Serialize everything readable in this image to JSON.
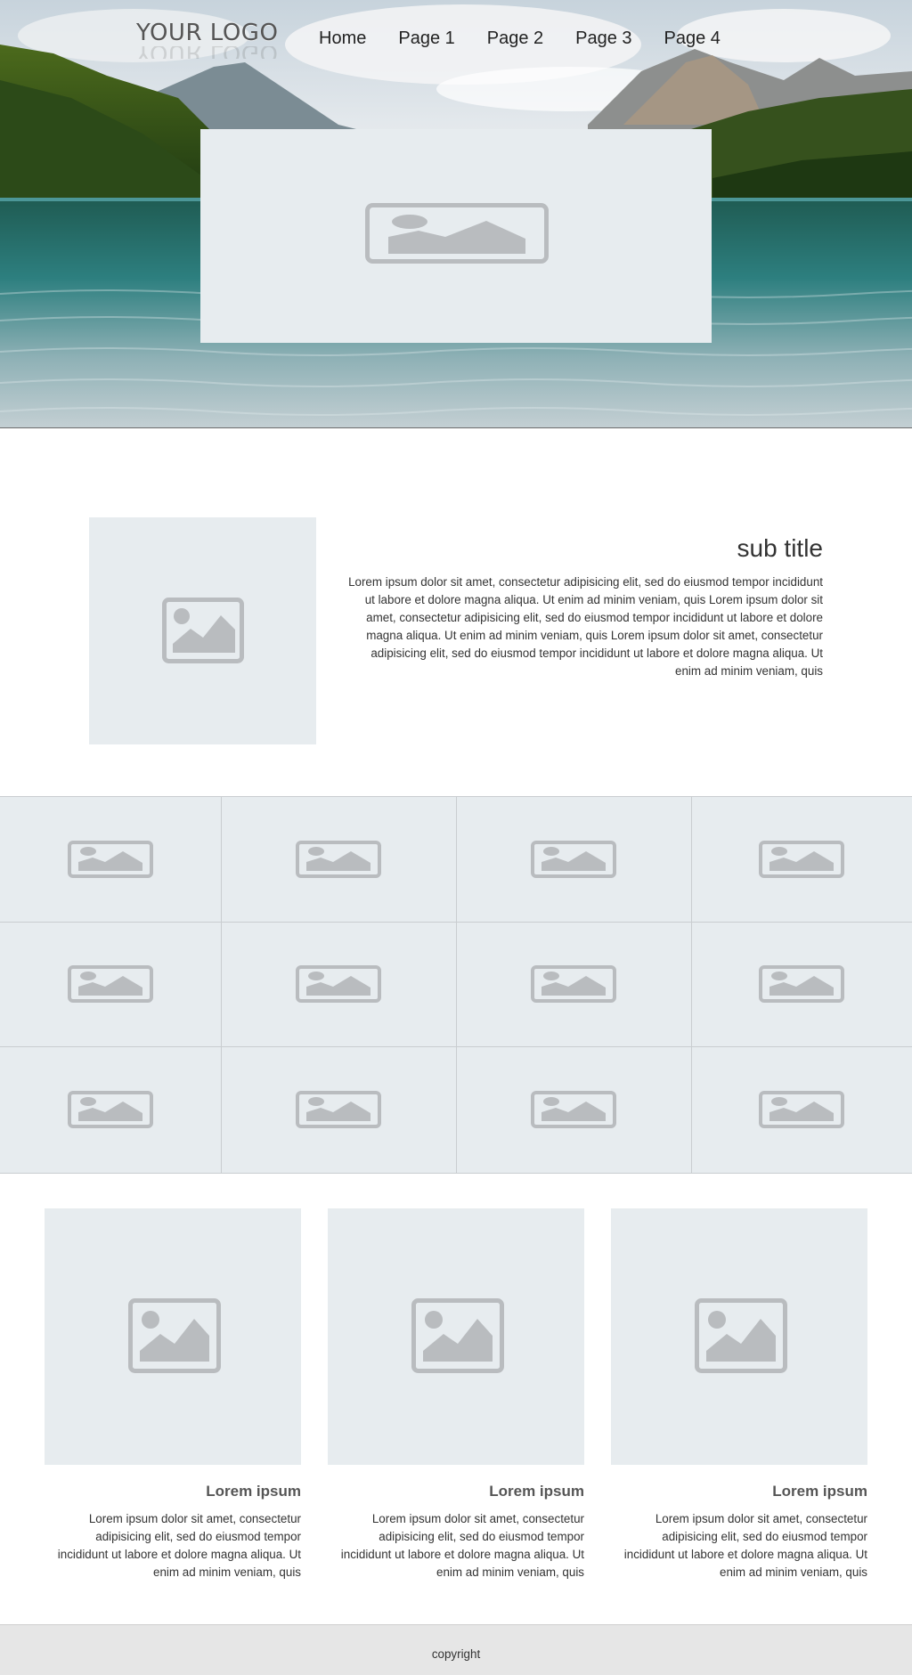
{
  "header": {
    "logo": "YOUR LOGO",
    "nav": [
      "Home",
      "Page 1",
      "Page 2",
      "Page 3",
      "Page 4"
    ]
  },
  "hero": {
    "image_icon": "image-placeholder-icon"
  },
  "feature": {
    "title": "sub title",
    "body": "Lorem ipsum dolor sit amet, consectetur adipisicing elit, sed do eiusmod tempor incididunt ut labore et dolore magna aliqua. Ut enim ad minim veniam, quis Lorem ipsum dolor sit amet, consectetur adipisicing elit, sed do eiusmod tempor incididunt ut labore et dolore magna aliqua. Ut enim ad minim veniam, quis Lorem ipsum dolor sit amet, consectetur adipisicing elit, sed do eiusmod tempor incididunt ut labore et dolore magna aliqua. Ut enim ad minim veniam, quis"
  },
  "gallery": {
    "rows": 3,
    "cols": 4,
    "icon": "image-placeholder-icon"
  },
  "cards": [
    {
      "title": "Lorem ipsum",
      "body": "Lorem ipsum dolor sit amet, consectetur adipisicing elit, sed do eiusmod tempor incididunt ut labore et dolore magna aliqua. Ut enim ad minim veniam, quis"
    },
    {
      "title": "Lorem ipsum",
      "body": "Lorem ipsum dolor sit amet, consectetur adipisicing elit, sed do eiusmod tempor incididunt ut labore et dolore magna aliqua. Ut enim ad minim veniam, quis"
    },
    {
      "title": "Lorem ipsum",
      "body": "Lorem ipsum dolor sit amet, consectetur adipisicing elit, sed do eiusmod tempor incididunt ut labore et dolore magna aliqua. Ut enim ad minim veniam, quis"
    }
  ],
  "footer": {
    "copyright": "copyright"
  },
  "colors": {
    "placeholder_bg": "#e7ecef",
    "placeholder_icon": "#b9bcbf",
    "footer_bg": "#e6e6e6"
  }
}
